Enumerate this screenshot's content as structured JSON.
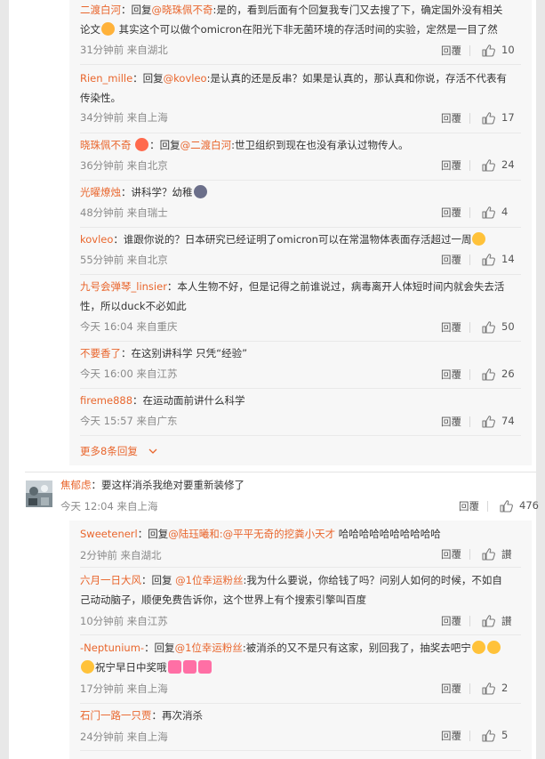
{
  "replies_block1": [
    {
      "user": "二渡白河",
      "line1_pre": "：回复",
      "mention": "@晓珠佩不奇",
      "line1_post": ":是的，看到后面有个回复我专门又去搜了下，确定国外没有相关",
      "line2_pre": "论文",
      "line2_post": " 其实这个可以做个omicron在阳光下非无菌环境的存活时间的实验，定然是一目了然",
      "time": "31分钟前 来自湖北",
      "reply": "回覆",
      "likes": "10"
    },
    {
      "user": "Rien_mille",
      "line1_pre": "：回复",
      "mention": "@kovleo",
      "line1_post": ":是认真的还是反串？如果是认真的，那认真和你说，存活不代表有",
      "line2": "传染性。",
      "time": "34分钟前 来自上海",
      "reply": "回覆",
      "likes": "17"
    },
    {
      "user": "晓珠佩不奇",
      "line1_pre": "：回复",
      "mention": "@二渡白河",
      "line1_post": ":世卫组织到现在也没有承认过物传人。",
      "time": "36分钟前 来自北京",
      "reply": "回覆",
      "likes": "24"
    },
    {
      "user": "光曜燎烛",
      "line1": "：讲科学？幼稚",
      "time": "48分钟前 来自瑞士",
      "reply": "回覆",
      "likes": "4"
    },
    {
      "user": "kovleo",
      "line1": "：谁跟你说的？日本研究已经证明了omicron可以在常温物体表面存活超过一周",
      "time": "55分钟前 来自北京",
      "reply": "回覆",
      "likes": "14"
    },
    {
      "user": "九号会弹琴_linsier",
      "line1": "：本人生物不好，但是记得之前谁说过，病毒离开人体短时间内就会失去活",
      "line2": "性，所以duck不必如此",
      "time": "今天 16:04 来自重庆",
      "reply": "回覆",
      "likes": "50"
    },
    {
      "user": "不要香了",
      "line1": "：在这别讲科学 只凭“经验”",
      "time": "今天 16:00 来自江苏",
      "reply": "回覆",
      "likes": "26"
    },
    {
      "user": "fireme888",
      "line1": "：在运动面前讲什么科学",
      "time": "今天 15:57 来自广东",
      "reply": "回覆",
      "likes": "74"
    }
  ],
  "more_replies": "更多8条回复",
  "main_comment": {
    "user": "焦郁虑",
    "text": "：要这样消杀我绝对要重新装修了",
    "time": "今天 12:04 来自上海",
    "reply": "回覆",
    "likes": "476"
  },
  "replies_block2": [
    {
      "user": "Sweetenerl",
      "line1_pre": "：回复",
      "mention": "@陆珏曦和:@平平无奇的挖粪小天才",
      "line1_post": " 哈哈哈哈哈哈哈哈哈哈",
      "time": "2分钟前 来自湖北",
      "reply": "回覆",
      "likes": "讃"
    },
    {
      "user": "六月一日大风",
      "line1_pre": "：回复 ",
      "mention": "@1位幸运粉丝",
      "line1_post": ":我为什么要说，你给钱了吗？问别人如何的时候，不如自",
      "line2": "己动动脑子，顺便免费告诉你，这个世界上有个搜索引擎叫百度",
      "time": "10分钟前 来自江苏",
      "reply": "回覆",
      "likes": "讃"
    },
    {
      "user": "-Neptunium-",
      "line1_pre": "：回复",
      "mention": "@1位幸运粉丝",
      "line1_post": ":被消杀的又不是只有这家，别回我了，抽奖去吧宁",
      "line2": "祝宁早日中奖哦",
      "time": "17分钟前 来自上海",
      "reply": "回覆",
      "likes": "2"
    },
    {
      "user": "石门一路一只贾",
      "line1": "：再次消杀",
      "time": "24分钟前 来自上海",
      "reply": "回覆",
      "likes": "5"
    }
  ],
  "colors": {
    "accent": "#e9662d",
    "meta": "#8a8a8a",
    "reply_bg": "#f7f7f7"
  }
}
